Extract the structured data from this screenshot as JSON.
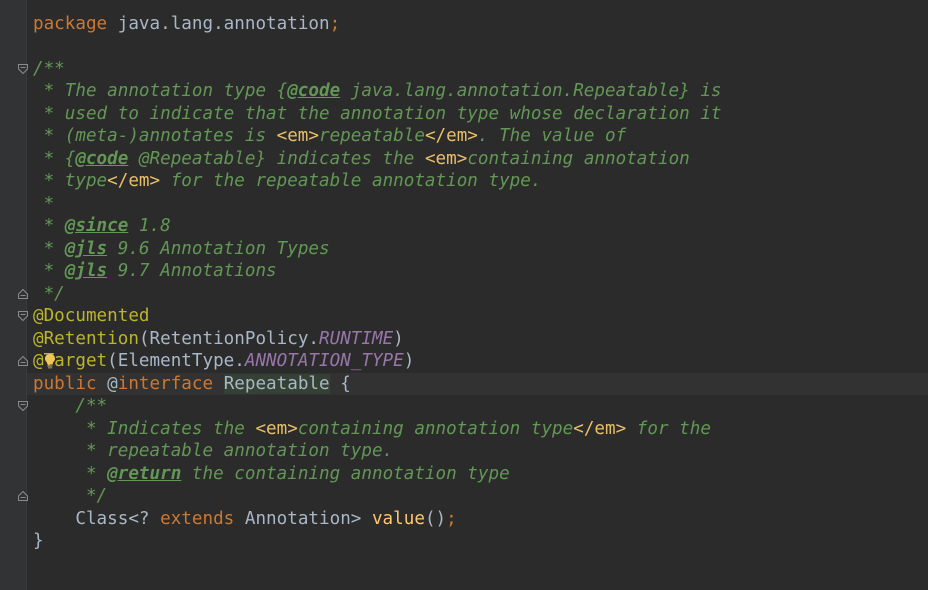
{
  "editor": {
    "lines": [
      {
        "tokens": [
          {
            "t": "package",
            "c": "kw"
          },
          {
            "t": " java.lang.annotation",
            "c": "pl"
          },
          {
            "t": ";",
            "c": "kw"
          }
        ]
      },
      {
        "tokens": []
      },
      {
        "tokens": [
          {
            "t": "/**",
            "c": "cm"
          }
        ]
      },
      {
        "tokens": [
          {
            "t": " * The annotation type {",
            "c": "cm"
          },
          {
            "t": "@code",
            "c": "tag"
          },
          {
            "t": " java.lang.annotation.Repeatable} is",
            "c": "cm"
          }
        ]
      },
      {
        "tokens": [
          {
            "t": " * used to indicate that the annotation type whose declaration it",
            "c": "cm"
          }
        ]
      },
      {
        "tokens": [
          {
            "t": " * (meta-)annotates is ",
            "c": "cm"
          },
          {
            "t": "<em>",
            "c": "html"
          },
          {
            "t": "repeatable",
            "c": "html-text"
          },
          {
            "t": "</em>",
            "c": "html"
          },
          {
            "t": ". The value of",
            "c": "cm"
          }
        ]
      },
      {
        "tokens": [
          {
            "t": " * {",
            "c": "cm"
          },
          {
            "t": "@code",
            "c": "tag"
          },
          {
            "t": " @Repeatable} indicates the ",
            "c": "cm"
          },
          {
            "t": "<em>",
            "c": "html"
          },
          {
            "t": "containing annotation",
            "c": "html-text"
          }
        ]
      },
      {
        "tokens": [
          {
            "t": " * type",
            "c": "cm"
          },
          {
            "t": "</em>",
            "c": "html"
          },
          {
            "t": " for the repeatable annotation type.",
            "c": "cm"
          }
        ]
      },
      {
        "tokens": [
          {
            "t": " *",
            "c": "cm"
          }
        ]
      },
      {
        "tokens": [
          {
            "t": " * ",
            "c": "cm"
          },
          {
            "t": "@since",
            "c": "tag"
          },
          {
            "t": " 1.8",
            "c": "cm"
          }
        ]
      },
      {
        "tokens": [
          {
            "t": " * ",
            "c": "cm"
          },
          {
            "t": "@jls",
            "c": "tag"
          },
          {
            "t": " 9.6 Annotation Types",
            "c": "cm"
          }
        ]
      },
      {
        "tokens": [
          {
            "t": " * ",
            "c": "cm"
          },
          {
            "t": "@jls",
            "c": "tag"
          },
          {
            "t": " 9.7 Annotations",
            "c": "cm"
          }
        ]
      },
      {
        "tokens": [
          {
            "t": " */",
            "c": "cm"
          }
        ]
      },
      {
        "tokens": [
          {
            "t": "@Documented",
            "c": "ann"
          }
        ]
      },
      {
        "tokens": [
          {
            "t": "@Retention",
            "c": "ann"
          },
          {
            "t": "(RetentionPolicy.",
            "c": "pl"
          },
          {
            "t": "RUNTIME",
            "c": "fld"
          },
          {
            "t": ")",
            "c": "pl"
          }
        ]
      },
      {
        "tokens": [
          {
            "t": "@Target",
            "c": "ann"
          },
          {
            "t": "(ElementType.",
            "c": "pl"
          },
          {
            "t": "ANNOTATION_TYPE",
            "c": "fld"
          },
          {
            "t": ")",
            "c": "pl"
          }
        ]
      },
      {
        "tokens": [
          {
            "t": "public ",
            "c": "kw"
          },
          {
            "t": "@",
            "c": "pl"
          },
          {
            "t": "interface ",
            "c": "kw"
          },
          {
            "t": "Repeatable",
            "c": "decl"
          },
          {
            "t": " {",
            "c": "pl"
          }
        ]
      },
      {
        "tokens": [
          {
            "t": "    /**",
            "c": "cm"
          }
        ]
      },
      {
        "tokens": [
          {
            "t": "     * Indicates the ",
            "c": "cm"
          },
          {
            "t": "<em>",
            "c": "html"
          },
          {
            "t": "containing annotation type",
            "c": "html-text"
          },
          {
            "t": "</em>",
            "c": "html"
          },
          {
            "t": " for the",
            "c": "cm"
          }
        ]
      },
      {
        "tokens": [
          {
            "t": "     * repeatable annotation type.",
            "c": "cm"
          }
        ]
      },
      {
        "tokens": [
          {
            "t": "     * ",
            "c": "cm"
          },
          {
            "t": "@return",
            "c": "tag"
          },
          {
            "t": " the containing annotation type",
            "c": "cm"
          }
        ]
      },
      {
        "tokens": [
          {
            "t": "     */",
            "c": "cm"
          }
        ]
      },
      {
        "tokens": [
          {
            "t": "    Class<? ",
            "c": "pl"
          },
          {
            "t": "extends ",
            "c": "kw"
          },
          {
            "t": "Annotation> ",
            "c": "pl"
          },
          {
            "t": "value",
            "c": "meth"
          },
          {
            "t": "()",
            "c": "pl"
          },
          {
            "t": ";",
            "c": "kw"
          }
        ]
      },
      {
        "tokens": [
          {
            "t": "}",
            "c": "pl"
          }
        ]
      }
    ],
    "fold_markers": [
      {
        "line": 2,
        "kind": "start"
      },
      {
        "line": 12,
        "kind": "end"
      },
      {
        "line": 13,
        "kind": "start"
      },
      {
        "line": 15,
        "kind": "end"
      },
      {
        "line": 17,
        "kind": "start"
      },
      {
        "line": 21,
        "kind": "end"
      }
    ],
    "intention_icon": "lightbulb-icon"
  }
}
